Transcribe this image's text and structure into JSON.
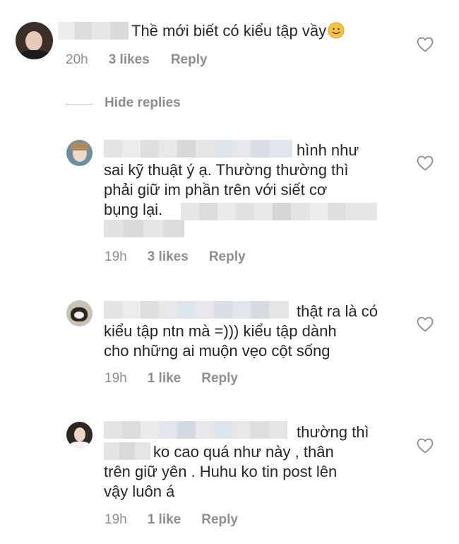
{
  "comment": {
    "text": "Thề mới biết có kiểu tập vầy",
    "emoji": "slightly-smiling-face",
    "time": "20h",
    "likes": "3 likes",
    "reply": "Reply"
  },
  "hide_replies": "Hide replies",
  "replies": [
    {
      "line1": "hình như",
      "line2": "sai kỹ thuật ý ạ. Thường thường thì",
      "line3": "phải giữ im phần trên với siết cơ",
      "line4": "bụng lại.",
      "time": "19h",
      "likes": "3 likes",
      "reply": "Reply"
    },
    {
      "line1": "thật ra là có",
      "line2": "kiểu tập ntn mà =))) kiểu tập dành",
      "line3": "cho những ai muộn vẹo cột sống",
      "time": "19h",
      "likes": "1 like",
      "reply": "Reply"
    },
    {
      "line1": "thường thì",
      "line2": "ko cao quá như này , thân",
      "line3": "trên giữ yên . Huhu ko tin post lên",
      "line4": "vậy luôn á",
      "time": "19h",
      "likes": "1 like",
      "reply": "Reply"
    }
  ],
  "colors": {
    "text": "#262626",
    "meta": "#8e8e8e",
    "heart": "#8e8e8e",
    "blur": [
      "#e4e4e6",
      "#d8d8da",
      "#ebebed",
      "#dadde3",
      "#e6e8ec",
      "#dde4ec",
      "#d3d6dc"
    ]
  },
  "icons": [
    "heart-outline-icon",
    "avatar"
  ]
}
